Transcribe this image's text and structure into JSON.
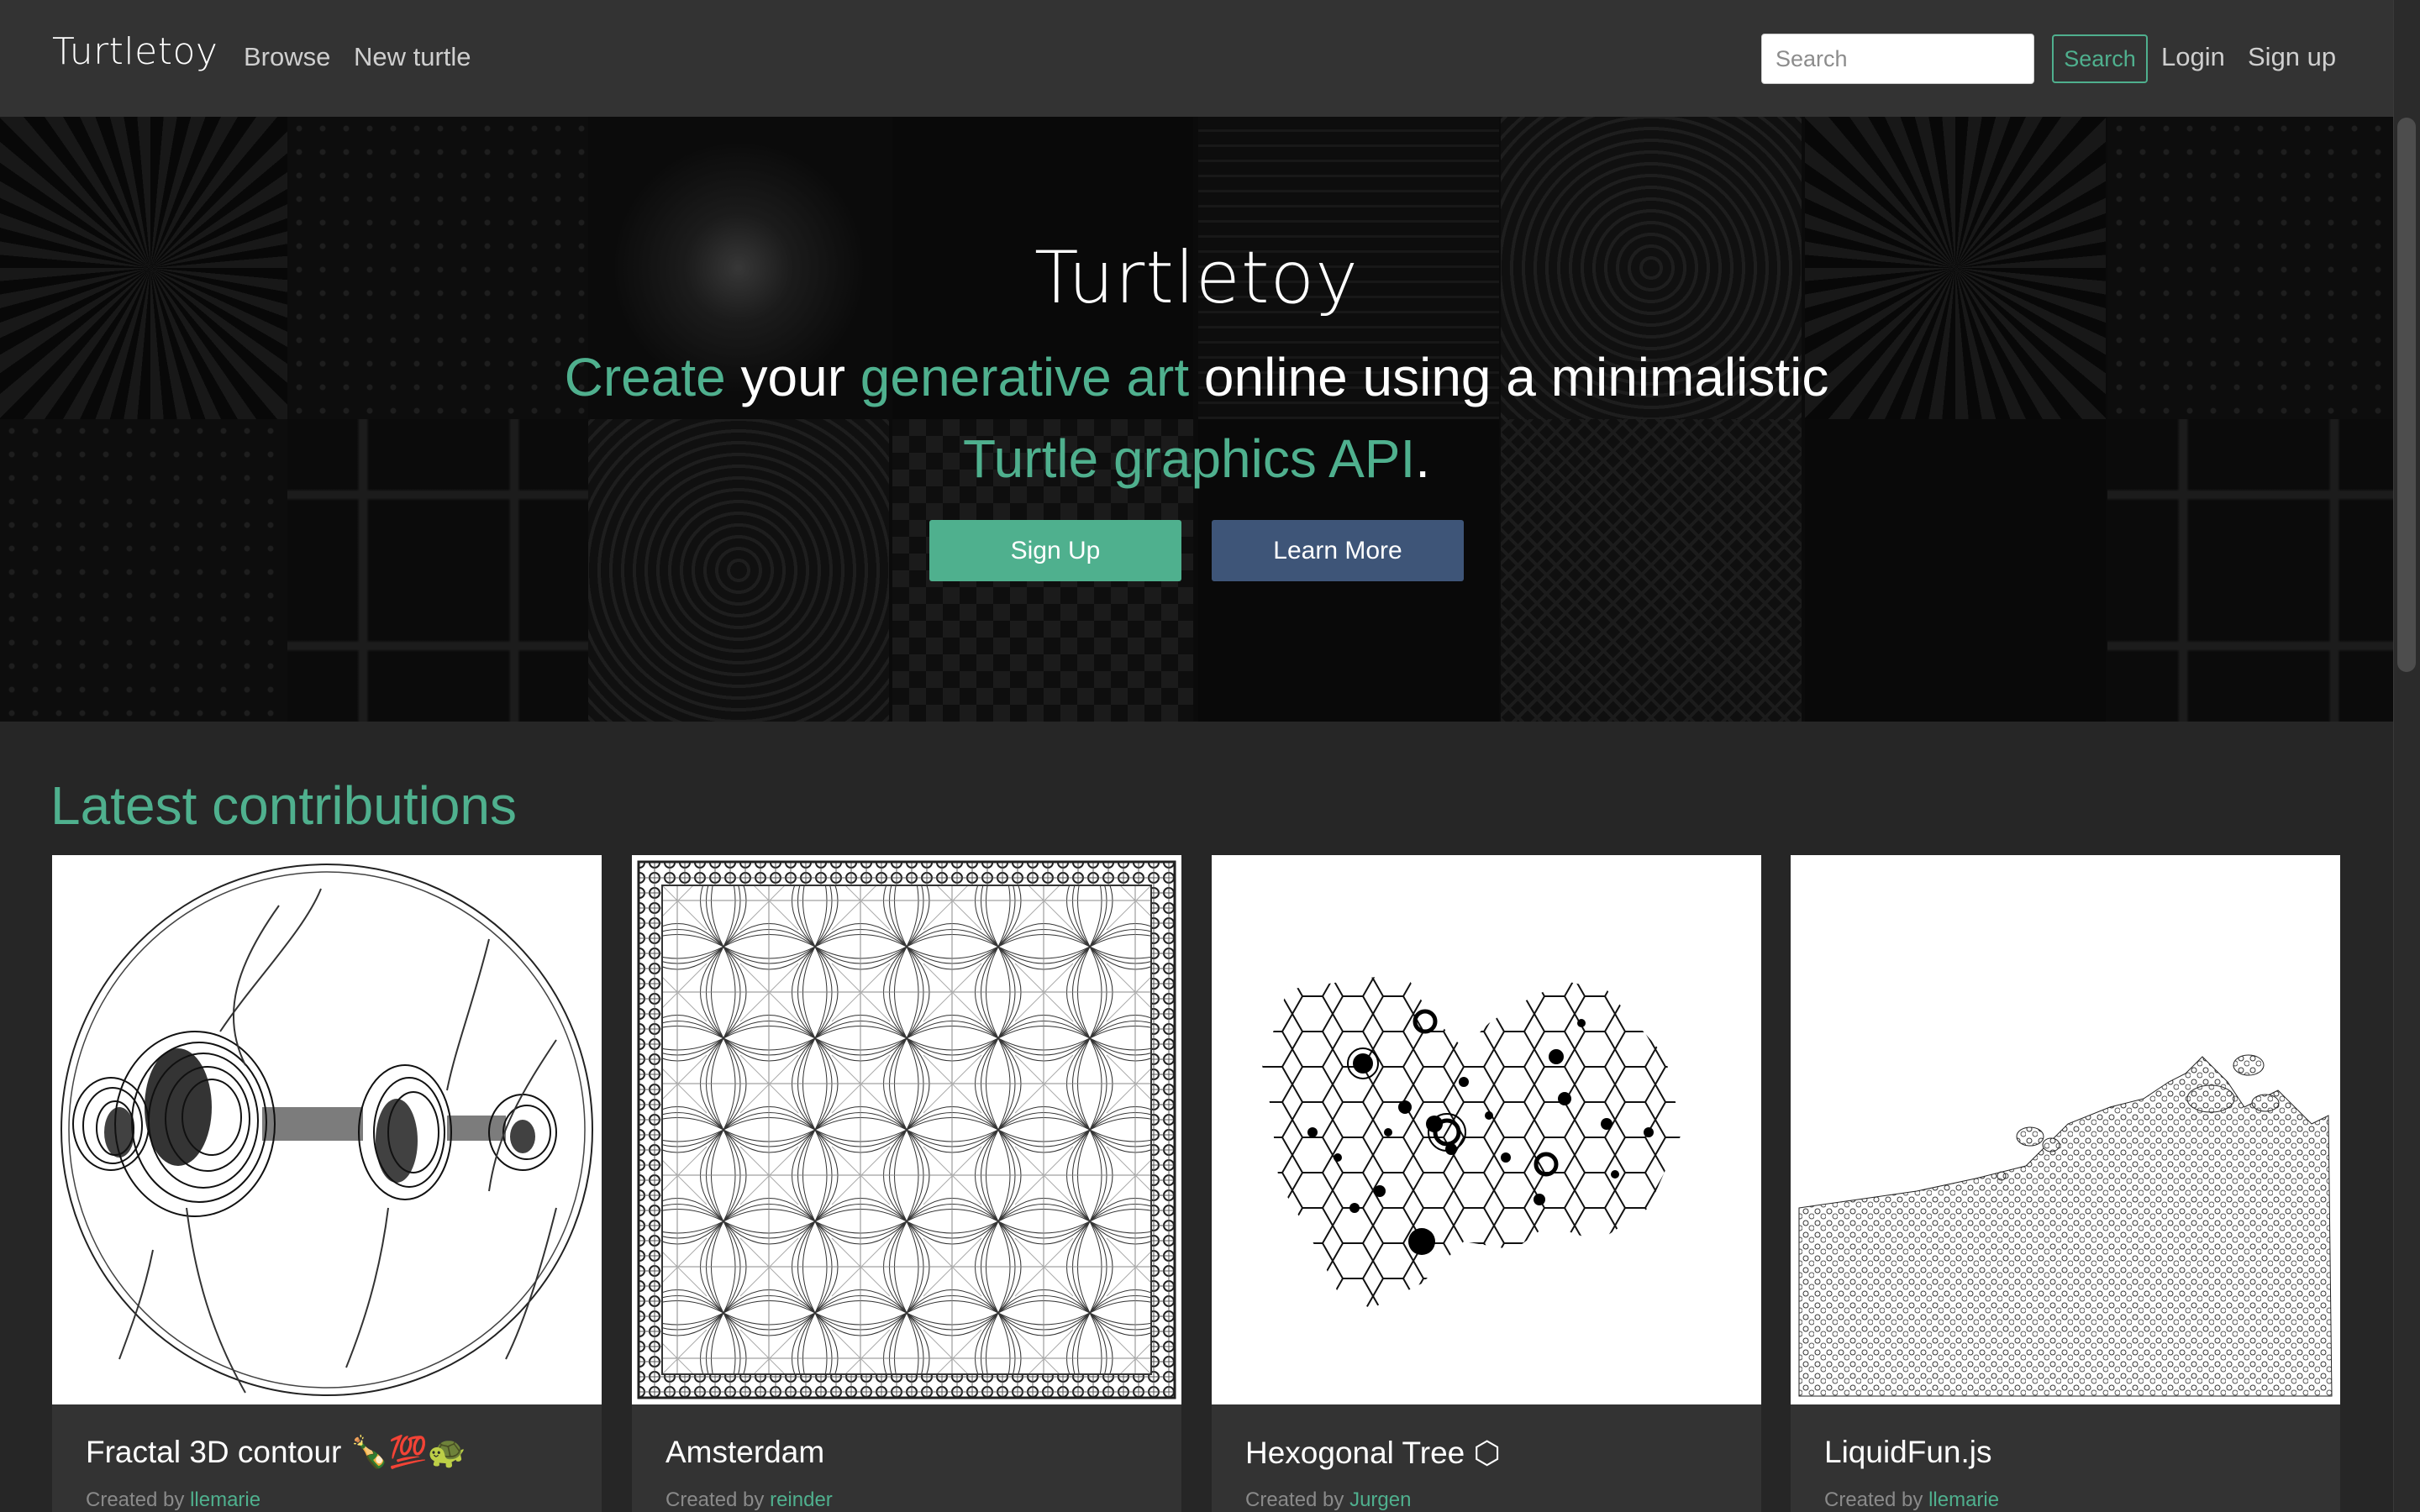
{
  "navbar": {
    "brand": "Turtletoy",
    "links": [
      "Browse",
      "New turtle"
    ],
    "search_placeholder": "Search",
    "search_button": "Search",
    "login": "Login",
    "signup": "Sign up"
  },
  "hero": {
    "title": "Turtletoy",
    "tagline": {
      "w1": "Create",
      "w2": " your ",
      "w3": "generative art",
      "w4": " online using a minimalistic ",
      "w5": "Turtle graphics API",
      "w6": "."
    },
    "signup_button": "Sign Up",
    "learn_more_button": "Learn More"
  },
  "section": {
    "title": "Latest contributions"
  },
  "cards": [
    {
      "title": "Fractal 3D contour 🍾💯🐢",
      "created_by": "Created by",
      "author": "llemarie"
    },
    {
      "title": "Amsterdam",
      "created_by": "Created by",
      "author": "reinder"
    },
    {
      "title": "Hexogonal Tree ⬡",
      "created_by": "Created by",
      "author": "Jurgen"
    },
    {
      "title": "LiquidFun.js",
      "created_by": "Created by",
      "author": "llemarie"
    }
  ],
  "colors": {
    "accent": "#4fb08e",
    "learn_more": "#3e5578",
    "background": "#262626",
    "navbar": "#333333"
  }
}
